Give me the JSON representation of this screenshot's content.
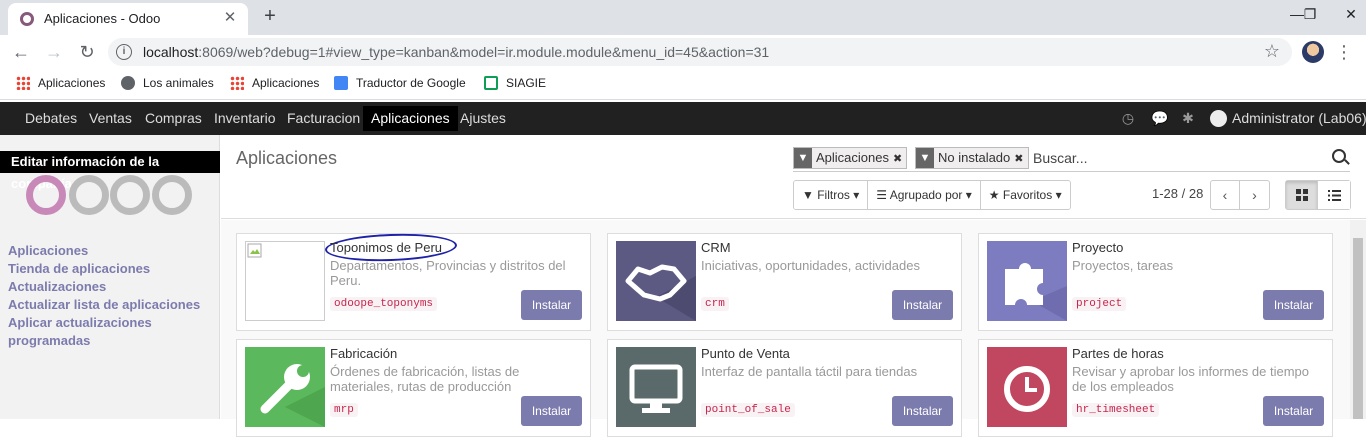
{
  "browser": {
    "tab_title": "Aplicaciones - Odoo",
    "url_host": "localhost",
    "url_rest": ":8069/web?debug=1#view_type=kanban&model=ir.module.module&menu_id=45&action=31",
    "bookmarks": [
      {
        "label": "Aplicaciones",
        "icon": "apps-grid-icon"
      },
      {
        "label": "Los animales",
        "icon": "globe-icon"
      },
      {
        "label": "Aplicaciones",
        "icon": "apps-grid-icon"
      },
      {
        "label": "Traductor de Google",
        "icon": "google-translate-icon"
      },
      {
        "label": "SIAGIE",
        "icon": "siagie-icon"
      }
    ]
  },
  "navbar": {
    "menus": [
      "Debates",
      "Ventas",
      "Compras",
      "Inventario",
      "Facturacion",
      "Aplicaciones",
      "Ajustes"
    ],
    "active": "Aplicaciones",
    "user": "Administrator (Lab06)"
  },
  "sidebar": {
    "tooltip": "Editar información de la compañía",
    "links": [
      "Aplicaciones",
      "Tienda de aplicaciones",
      "Actualizaciones",
      "Actualizar lista de aplicaciones",
      "Aplicar actualizaciones",
      "programadas"
    ]
  },
  "control_panel": {
    "breadcrumb": "Aplicaciones",
    "facets": [
      "Aplicaciones",
      "No instalado"
    ],
    "search_placeholder": "Buscar...",
    "filters_label": "Filtros",
    "group_label": "Agrupado por",
    "favorites_label": "Favoritos",
    "pager": "1-28 / 28"
  },
  "apps": [
    {
      "title": "Toponimos de Peru",
      "summary": "Departamentos, Provincias y distritos del Peru.",
      "technical": "odoope_toponyms",
      "button": "Instalar",
      "icon": "broken-image-icon",
      "color": "#ffffff"
    },
    {
      "title": "CRM",
      "summary": "Iniciativas, oportunidades, actividades",
      "technical": "crm",
      "button": "Instalar",
      "icon": "handshake-icon",
      "color": "#5c5a82"
    },
    {
      "title": "Proyecto",
      "summary": "Proyectos, tareas",
      "technical": "project",
      "button": "Instalar",
      "icon": "puzzle-icon",
      "color": "#7e7cc0"
    },
    {
      "title": "Fabricación",
      "summary": "Órdenes de fabricación, listas de materiales, rutas de producción",
      "technical": "mrp",
      "button": "Instalar",
      "icon": "wrench-icon",
      "color": "#5cb85c"
    },
    {
      "title": "Punto de Venta",
      "summary": "Interfaz de pantalla táctil para tiendas",
      "technical": "point_of_sale",
      "button": "Instalar",
      "icon": "monitor-icon",
      "color": "#5a6a6a"
    },
    {
      "title": "Partes de horas",
      "summary": "Revisar y aprobar los informes de tiempo de los empleados",
      "technical": "hr_timesheet",
      "button": "Instalar",
      "icon": "clock-icon",
      "color": "#c0475f"
    }
  ]
}
